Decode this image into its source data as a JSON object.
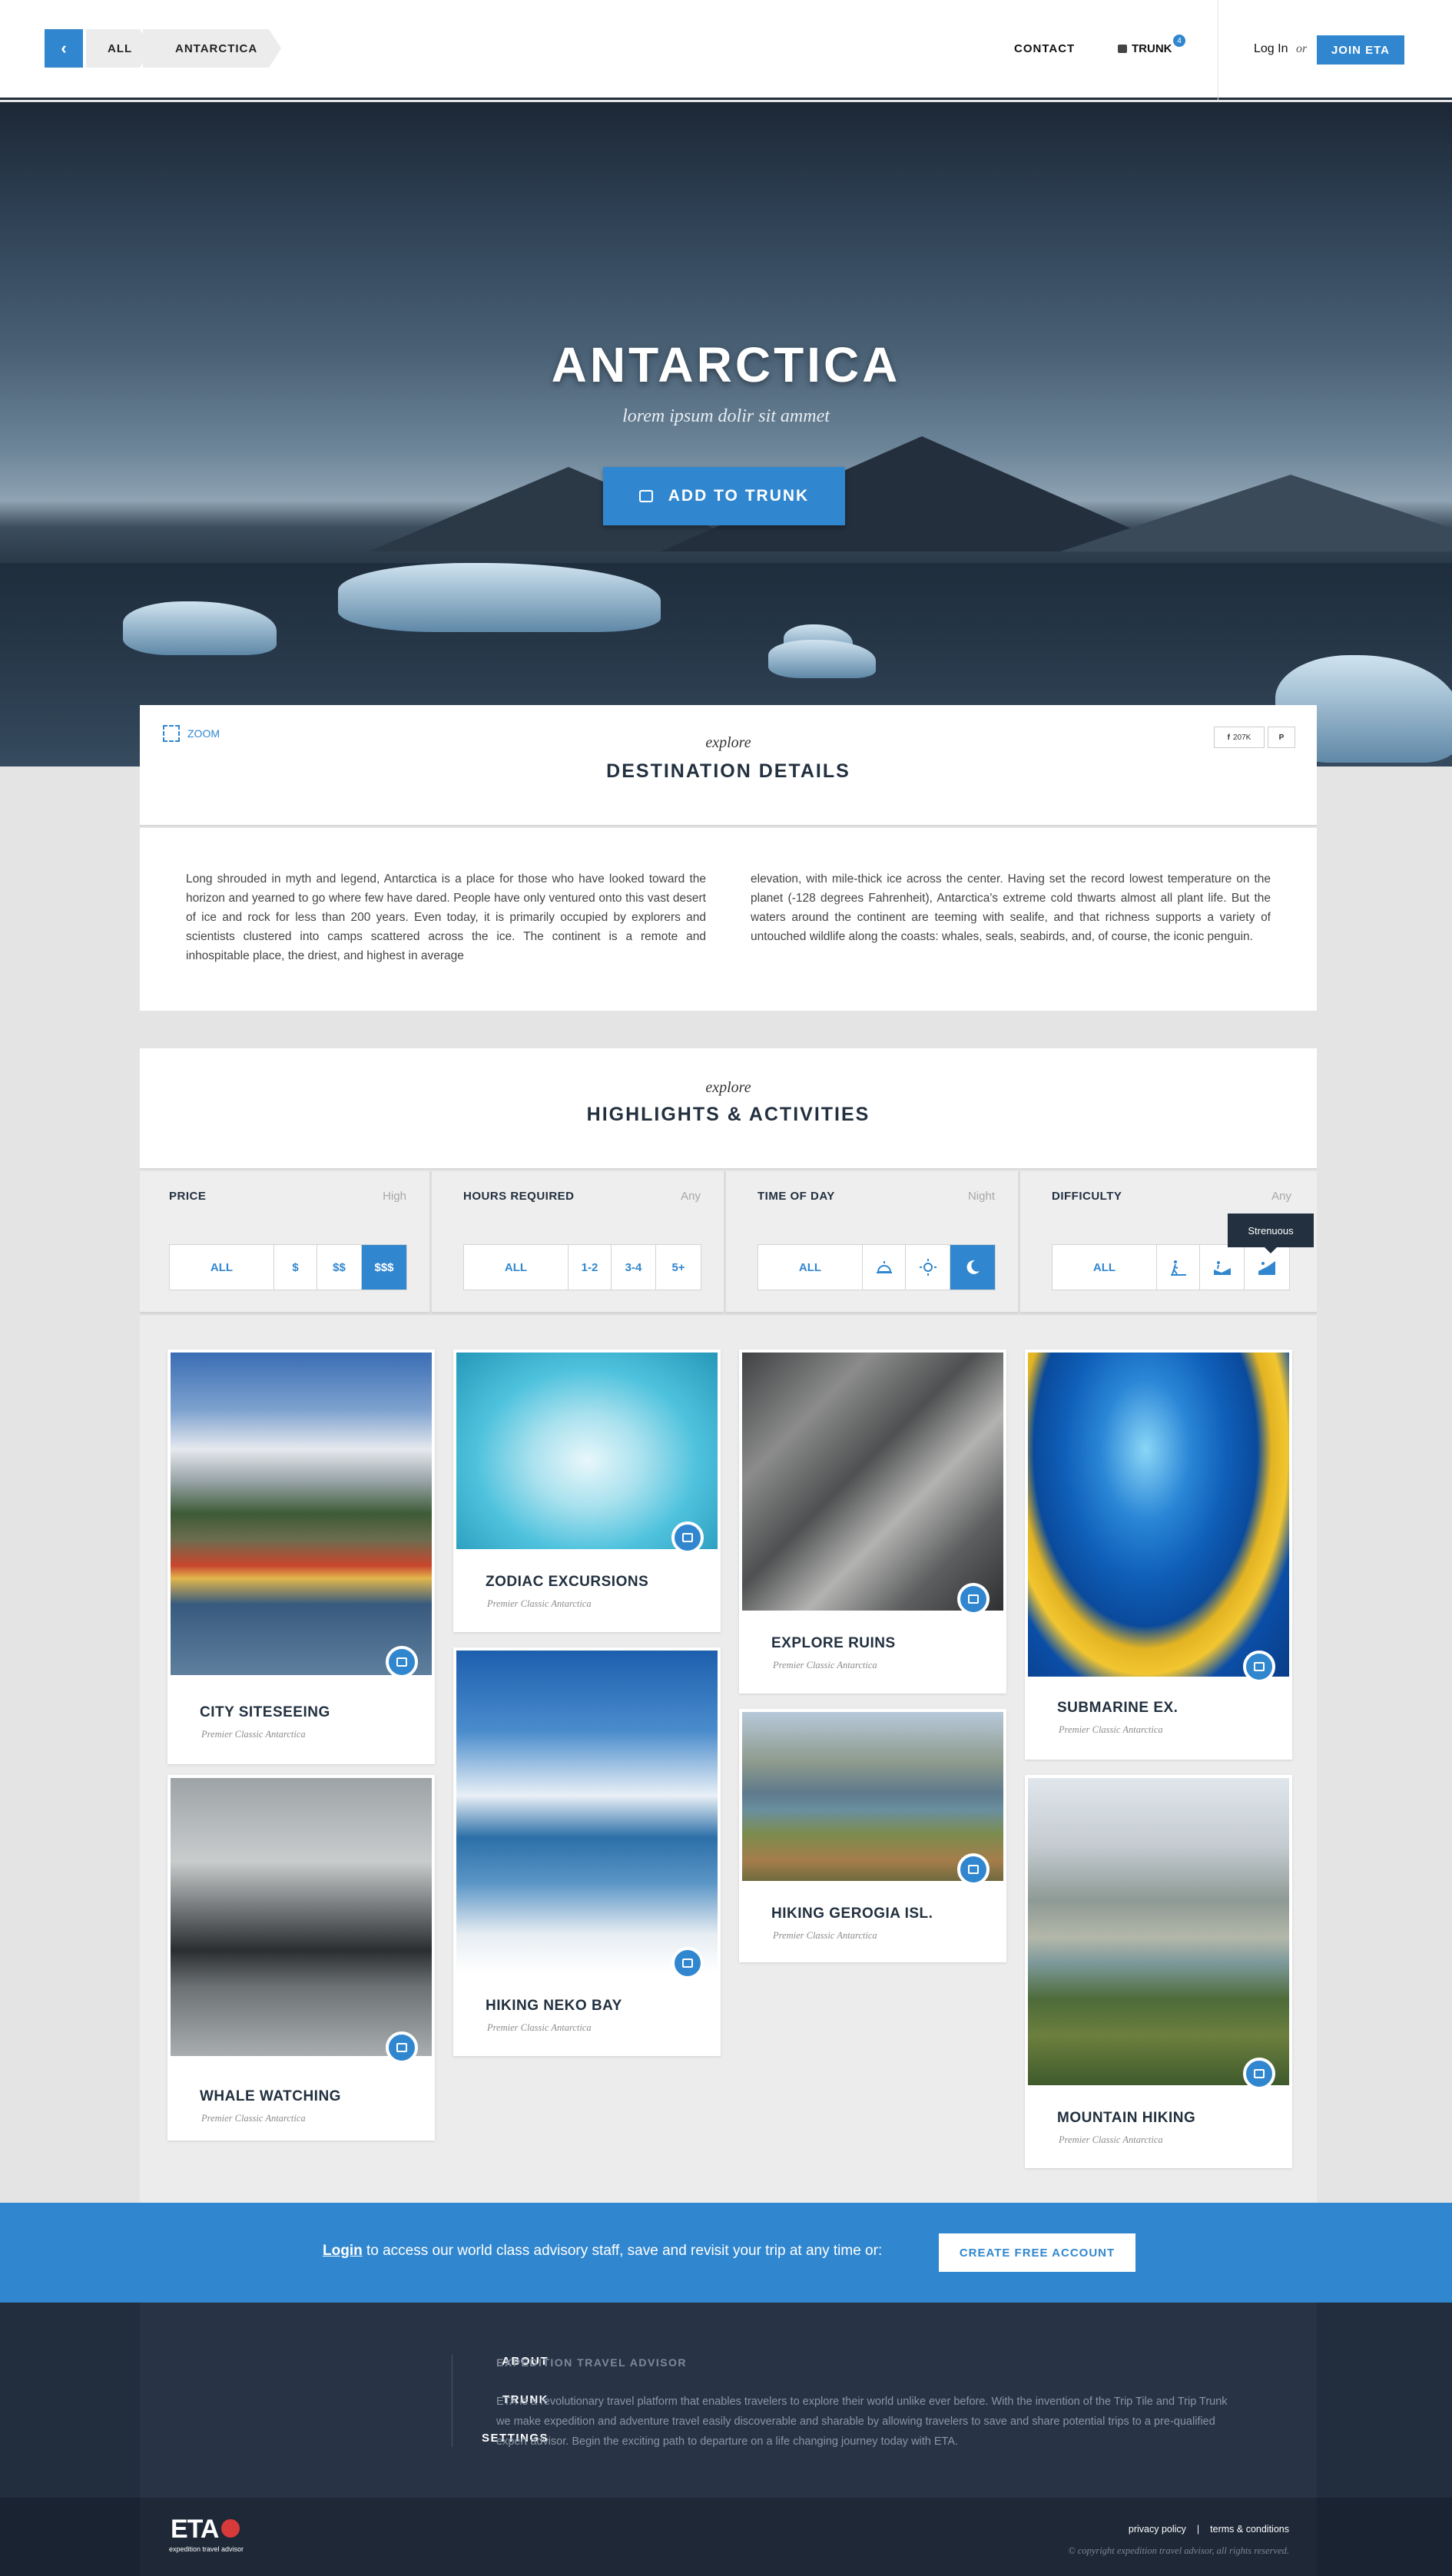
{
  "header": {
    "back_icon": "chevron-left-icon",
    "breadcrumb": [
      "ALL",
      "ANTARCTICA"
    ],
    "contact": "CONTACT",
    "trunk": "TRUNK",
    "trunk_count": "4",
    "login": "Log In",
    "or": "or",
    "join": "JOIN ETA",
    "accent": "#3187cf"
  },
  "hero": {
    "title": "ANTARCTICA",
    "subtitle": "lorem ipsum dolir sit ammet",
    "cta": "ADD TO TRUNK"
  },
  "destination": {
    "zoom": "ZOOM",
    "share_count": "207K",
    "explore": "explore",
    "title": "DESTINATION DETAILS",
    "text_left": "Long shrouded in myth and legend, Antarctica is a place for those who have looked toward the horizon and yearned to go where few have dared. People have only ventured onto this vast desert of ice and rock for less than 200 years. Even today, it is primarily occupied by explorers and scientists clustered into camps scattered across the ice. The continent is a remote and inhospitable place, the driest, and highest in average",
    "text_right": "elevation, with mile-thick ice across the center. Having set the record lowest temperature on the planet (-128 degrees Fahrenheit), Antarctica's extreme cold thwarts almost all plant life. But the waters around the continent are teeming with sealife, and that richness supports a variety of untouched wildlife along the coasts: whales, seals, seabirds, and, of course, the iconic penguin."
  },
  "highlights": {
    "explore": "explore",
    "title": "HIGHLIGHTS & ACTIVITIES"
  },
  "filters": {
    "price": {
      "label": "PRICE",
      "value": "High",
      "options": [
        "ALL",
        "$",
        "$$",
        "$$$"
      ]
    },
    "hours": {
      "label": "HOURS REQUIRED",
      "value": "Any",
      "options": [
        "ALL",
        "1-2",
        "3-4",
        "5+"
      ]
    },
    "time": {
      "label": "TIME OF DAY",
      "value": "Night",
      "all": "ALL"
    },
    "difficulty": {
      "label": "DIFFICULTY",
      "value": "Any",
      "all": "ALL",
      "tooltip": "Strenuous"
    }
  },
  "tiles": [
    {
      "name": "CITY SITESEEING",
      "sub": "Premier Classic Antarctica"
    },
    {
      "name": "ZODIAC EXCURSIONS",
      "sub": "Premier Classic Antarctica"
    },
    {
      "name": "EXPLORE RUINS",
      "sub": "Premier Classic Antarctica"
    },
    {
      "name": "SUBMARINE EX.",
      "sub": "Premier Classic Antarctica"
    },
    {
      "name": "WHALE WATCHING",
      "sub": "Premier Classic Antarctica"
    },
    {
      "name": "HIKING NEKO BAY",
      "sub": "Premier Classic Antarctica"
    },
    {
      "name": "HIKING GEROGIA ISL.",
      "sub": "Premier Classic Antarctica"
    },
    {
      "name": "MOUNTAIN HIKING",
      "sub": "Premier Classic Antarctica"
    }
  ],
  "cta": {
    "login": "Login",
    "text": " to access our world class advisory staff, save and revisit your trip at any time or:",
    "button": "CREATE FREE ACCOUNT"
  },
  "footer": {
    "links": [
      "ABOUT",
      "TRUNK",
      "SETTINGS"
    ],
    "title": "EXPEDITION TRAVEL ADVISOR",
    "desc": "ETA is a revolutionary travel platform that enables travelers to explore their world unlike ever before. With the invention of the Trip Tile and Trip Trunk we make expedition and adventure travel easily discoverable and sharable by allowing travelers to save and share potential trips to a pre-qualified expert advisor.  Begin the exciting path to departure on a life changing journey today with ETA.",
    "logo": "ETA",
    "logo_sub": "expedition travel advisor",
    "privacy": "privacy policy",
    "sep": "|",
    "terms": "terms & conditions",
    "copyright": "© copyright expedition travel advisor, all rights reserved."
  }
}
